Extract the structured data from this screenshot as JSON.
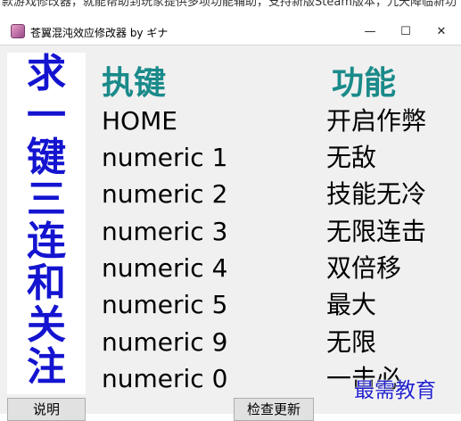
{
  "top_strip_text": "款游戏修改器，就能帮助到玩家提供多项功能辅助，支持新版Steam版本，九天降临新功",
  "window": {
    "title": "苍翼混沌效应修改器 by ギナ",
    "minimize_glyph": "—",
    "maximize_glyph": "☐",
    "close_glyph": "✕"
  },
  "side_banner": [
    "求",
    "一",
    "键",
    "三",
    "连",
    "和",
    "关",
    "注"
  ],
  "table": {
    "key_header": "执键",
    "func_header": "功能",
    "rows": [
      {
        "key": "HOME",
        "func": "开启作弊"
      },
      {
        "key": "numeric 1",
        "func": "无敌"
      },
      {
        "key": "numeric 2",
        "func": "技能无冷"
      },
      {
        "key": "numeric 3",
        "func": "无限连击"
      },
      {
        "key": "numeric 4",
        "func": "双倍移"
      },
      {
        "key": "numeric 5",
        "func": "最大"
      },
      {
        "key": "numeric 9",
        "func": "无限"
      },
      {
        "key": "numeric 0",
        "func": "一击必"
      }
    ]
  },
  "buttons": {
    "help": "说明",
    "update": "检查更新"
  },
  "watermark": "最需教育",
  "colors": {
    "header_teal": "#1a8a8a",
    "banner_blue": "#1414d0",
    "client_bg": "#f0f0f0"
  }
}
